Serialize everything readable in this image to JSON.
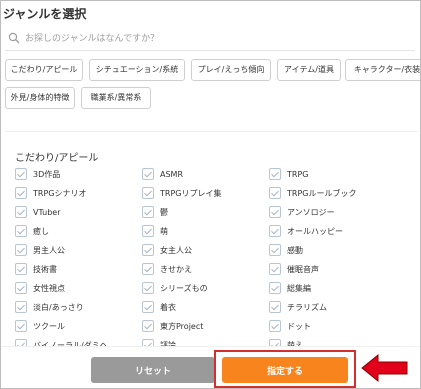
{
  "dialog": {
    "title": "ジャンルを選択"
  },
  "search": {
    "placeholder": "お探しのジャンルはなんですか？"
  },
  "categories": [
    "こだわり/アピール",
    "シチュエーション/系統",
    "プレイ/えっち傾向",
    "アイテム/道具",
    "キャラクター/衣装",
    "外見/身体的特徴",
    "職業系/異常系"
  ],
  "section": {
    "title": "こだわり/アピール"
  },
  "options": [
    "3D作品",
    "ASMR",
    "TRPG",
    "TRPGシナリオ",
    "TRPGリプレイ集",
    "TRPGルールブック",
    "VTuber",
    "鬱",
    "アンソロジー",
    "癒し",
    "萌",
    "オールハッピー",
    "男主人公",
    "女主人公",
    "感動",
    "技術書",
    "きせかえ",
    "催眠音声",
    "女性視点",
    "シリーズもの",
    "総集編",
    "淡白/あっさり",
    "着衣",
    "チラリズム",
    "ツクール",
    "東方Project",
    "ドット",
    "バイノーラル/ダミヘ",
    "評論",
    "萌え"
  ],
  "footer": {
    "reset_label": "リセット",
    "confirm_label": "指定する"
  },
  "colors": {
    "confirm": "#f7841d",
    "reset": "#9a9a9a",
    "highlight": "#d32f2f",
    "arrow": "#e2001a"
  }
}
